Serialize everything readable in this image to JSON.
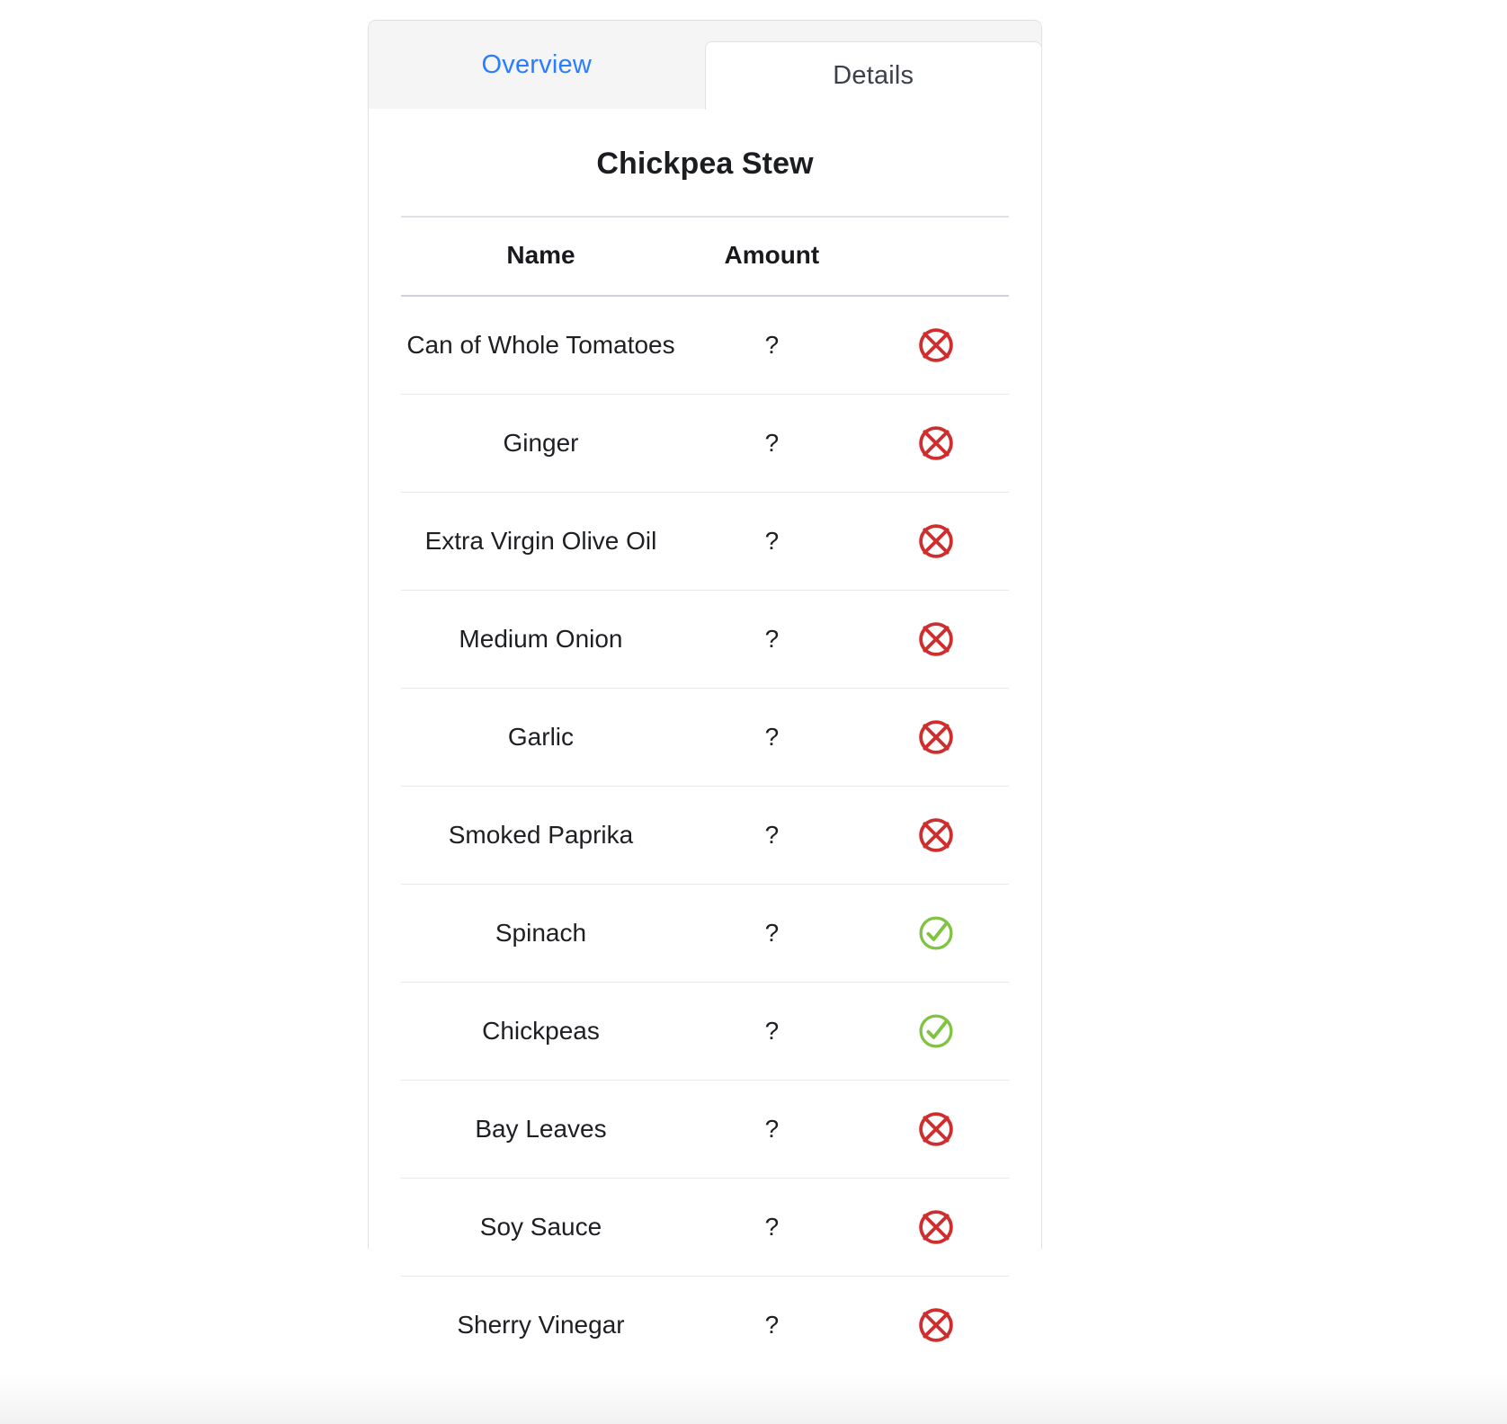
{
  "tabs": [
    {
      "label": "Overview",
      "active": false
    },
    {
      "label": "Details",
      "active": true
    }
  ],
  "recipe": {
    "title": "Chickpea Stew"
  },
  "table": {
    "columns": [
      "Name",
      "Amount"
    ],
    "rows": [
      {
        "name": "Can of Whole Tomatoes",
        "amount": "?",
        "status": "missing"
      },
      {
        "name": "Ginger",
        "amount": "?",
        "status": "missing"
      },
      {
        "name": "Extra Virgin Olive Oil",
        "amount": "?",
        "status": "missing"
      },
      {
        "name": "Medium Onion",
        "amount": "?",
        "status": "missing"
      },
      {
        "name": "Garlic",
        "amount": "?",
        "status": "missing"
      },
      {
        "name": "Smoked Paprika",
        "amount": "?",
        "status": "missing"
      },
      {
        "name": "Spinach",
        "amount": "?",
        "status": "available"
      },
      {
        "name": "Chickpeas",
        "amount": "?",
        "status": "available"
      },
      {
        "name": "Bay Leaves",
        "amount": "?",
        "status": "missing"
      },
      {
        "name": "Soy Sauce",
        "amount": "?",
        "status": "missing"
      },
      {
        "name": "Sherry Vinegar",
        "amount": "?",
        "status": "missing"
      }
    ]
  },
  "icons": {
    "missing": "x-circle-icon",
    "available": "check-circle-icon"
  },
  "colors": {
    "tab_inactive_text": "#2b7cff",
    "tab_active_text": "#3c4149",
    "tab_strip_bg": "#f5f5f6",
    "card_border": "#dfe1e5",
    "title_text": "#1b1d20",
    "status_missing": "#cf2e2e",
    "status_available": "#80c341",
    "row_divider": "#e6e8ec"
  }
}
